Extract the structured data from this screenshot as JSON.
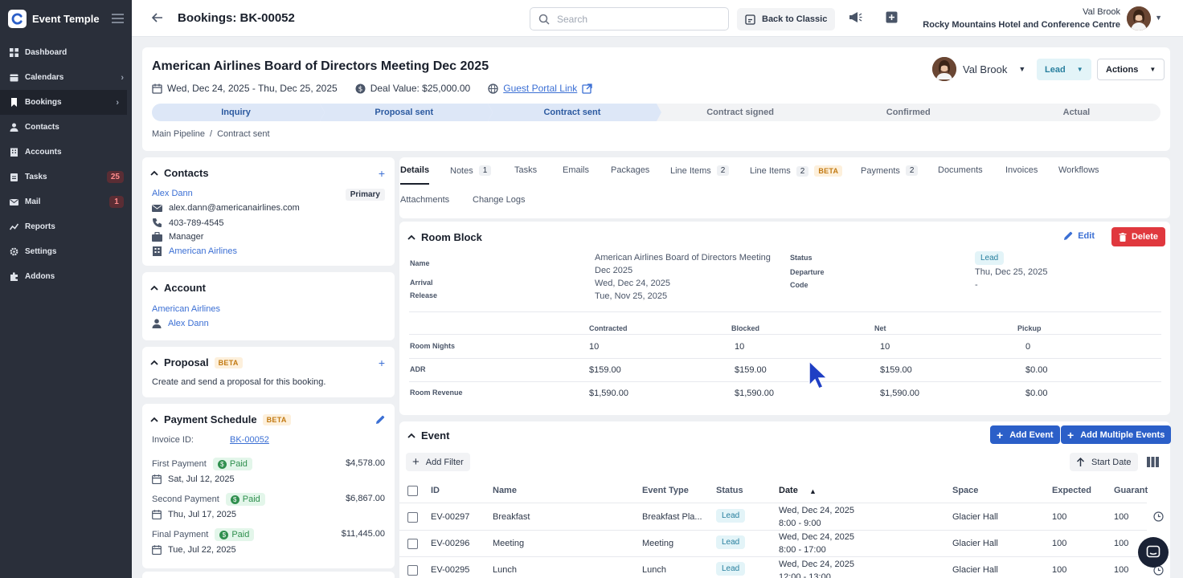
{
  "sidebar": {
    "brand": "Event Temple",
    "items": [
      {
        "label": "Dashboard",
        "icon": "dashboard-icon"
      },
      {
        "label": "Calendars",
        "icon": "calendar-icon"
      },
      {
        "label": "Bookings",
        "icon": "bookmark-icon"
      },
      {
        "label": "Contacts",
        "icon": "person-icon"
      },
      {
        "label": "Accounts",
        "icon": "building-icon"
      },
      {
        "label": "Tasks",
        "icon": "clipboard-icon",
        "badge": "25"
      },
      {
        "label": "Mail",
        "icon": "mail-icon",
        "badge": "1"
      },
      {
        "label": "Reports",
        "icon": "chart-icon"
      },
      {
        "label": "Settings",
        "icon": "gear-icon"
      },
      {
        "label": "Addons",
        "icon": "puzzle-icon"
      }
    ]
  },
  "topbar": {
    "title": "Bookings: BK-00052",
    "search_placeholder": "Search",
    "back_to_classic": "Back to Classic",
    "user_name": "Val Brook",
    "hotel": "Rocky Mountains Hotel and Conference Centre"
  },
  "booking": {
    "title": "American Airlines Board of Directors Meeting Dec 2025",
    "dates": "Wed, Dec 24, 2025 - Thu, Dec 25, 2025",
    "deal_value": "Deal Value: $25,000.00",
    "portal_link": "Guest Portal Link",
    "owner": "Val Brook",
    "status": "Lead",
    "actions": "Actions",
    "stages": [
      {
        "label": "Inquiry",
        "done": true
      },
      {
        "label": "Proposal sent",
        "done": true
      },
      {
        "label": "Contract sent",
        "done": true
      },
      {
        "label": "Contract signed",
        "done": false
      },
      {
        "label": "Confirmed",
        "done": false
      },
      {
        "label": "Actual",
        "done": false
      }
    ],
    "breadcrumb": {
      "pipeline": "Main Pipeline",
      "sep": "/",
      "stage": "Contract sent"
    }
  },
  "contacts": {
    "title": "Contacts",
    "name": "Alex Dann",
    "tag": "Primary",
    "email": "alex.dann@americanairlines.com",
    "phone": "403-789-4545",
    "role": "Manager",
    "company": "American Airlines"
  },
  "account": {
    "title": "Account",
    "name": "American Airlines",
    "contact": "Alex Dann"
  },
  "proposal": {
    "title": "Proposal",
    "beta": "BETA",
    "text": "Create and send a proposal for this booking."
  },
  "payment_schedule": {
    "title": "Payment Schedule",
    "beta": "BETA",
    "invoice_label": "Invoice ID:",
    "invoice_id": "BK-00052",
    "payments": [
      {
        "label": "First Payment",
        "status": "Paid",
        "amount": "$4,578.00",
        "date": "Sat, Jul 12, 2025"
      },
      {
        "label": "Second Payment",
        "status": "Paid",
        "amount": "$6,867.00",
        "date": "Thu, Jul 17, 2025"
      },
      {
        "label": "Final Payment",
        "status": "Paid",
        "amount": "$11,445.00",
        "date": "Tue, Jul 22, 2025"
      }
    ]
  },
  "tabs": {
    "row1": [
      {
        "label": "Details",
        "active": true
      },
      {
        "label": "Notes",
        "count": "1"
      },
      {
        "label": "Tasks"
      },
      {
        "label": "Emails"
      },
      {
        "label": "Packages"
      },
      {
        "label": "Line Items",
        "count": "2"
      },
      {
        "label": "Line Items",
        "count": "2",
        "beta": "BETA"
      },
      {
        "label": "Payments",
        "count": "2"
      },
      {
        "label": "Documents"
      },
      {
        "label": "Invoices"
      },
      {
        "label": "Workflows"
      }
    ],
    "row2": [
      {
        "label": "Attachments"
      },
      {
        "label": "Change Logs"
      }
    ]
  },
  "room_block": {
    "title": "Room Block",
    "edit": "Edit",
    "delete": "Delete",
    "labels": {
      "name": "Name",
      "arrival": "Arrival",
      "release": "Release",
      "status": "Status",
      "departure": "Departure",
      "code": "Code"
    },
    "values": {
      "name": "American Airlines Board of Directors Meeting Dec 2025",
      "arrival": "Wed, Dec 24, 2025",
      "release": "Tue, Nov 25, 2025",
      "status": "Lead",
      "departure": "Thu, Dec 25, 2025",
      "code": "-"
    },
    "columns": [
      "Contracted",
      "Blocked",
      "Net",
      "Pickup"
    ],
    "rows": [
      {
        "label": "Room Nights",
        "values": [
          "10",
          "10",
          "10",
          "0"
        ]
      },
      {
        "label": "ADR",
        "values": [
          "$159.00",
          "$159.00",
          "$159.00",
          "$0.00"
        ]
      },
      {
        "label": "Room Revenue",
        "values": [
          "$1,590.00",
          "$1,590.00",
          "$1,590.00",
          "$0.00"
        ]
      }
    ]
  },
  "events": {
    "title": "Event",
    "add_event": "Add Event",
    "add_multiple": "Add Multiple Events",
    "add_filter": "Add Filter",
    "sort": "Start Date",
    "columns": [
      "ID",
      "Name",
      "Event Type",
      "Status",
      "Date",
      "Space",
      "Expected",
      "Guarant"
    ],
    "rows": [
      {
        "id": "EV-00297",
        "name": "Breakfast",
        "type": "Breakfast Pla...",
        "status": "Lead",
        "date": "Wed, Dec 24, 2025",
        "time": "8:00 - 9:00",
        "space": "Glacier Hall",
        "expected": "100",
        "guaranteed": "100"
      },
      {
        "id": "EV-00296",
        "name": "Meeting",
        "type": "Meeting",
        "status": "Lead",
        "date": "Wed, Dec 24, 2025",
        "time": "8:00 - 17:00",
        "space": "Glacier Hall",
        "expected": "100",
        "guaranteed": "100"
      },
      {
        "id": "EV-00295",
        "name": "Lunch",
        "type": "Lunch",
        "status": "Lead",
        "date": "Wed, Dec 24, 2025",
        "time": "12:00 - 13:00",
        "space": "Glacier Hall",
        "expected": "100",
        "guaranteed": "100"
      }
    ]
  }
}
